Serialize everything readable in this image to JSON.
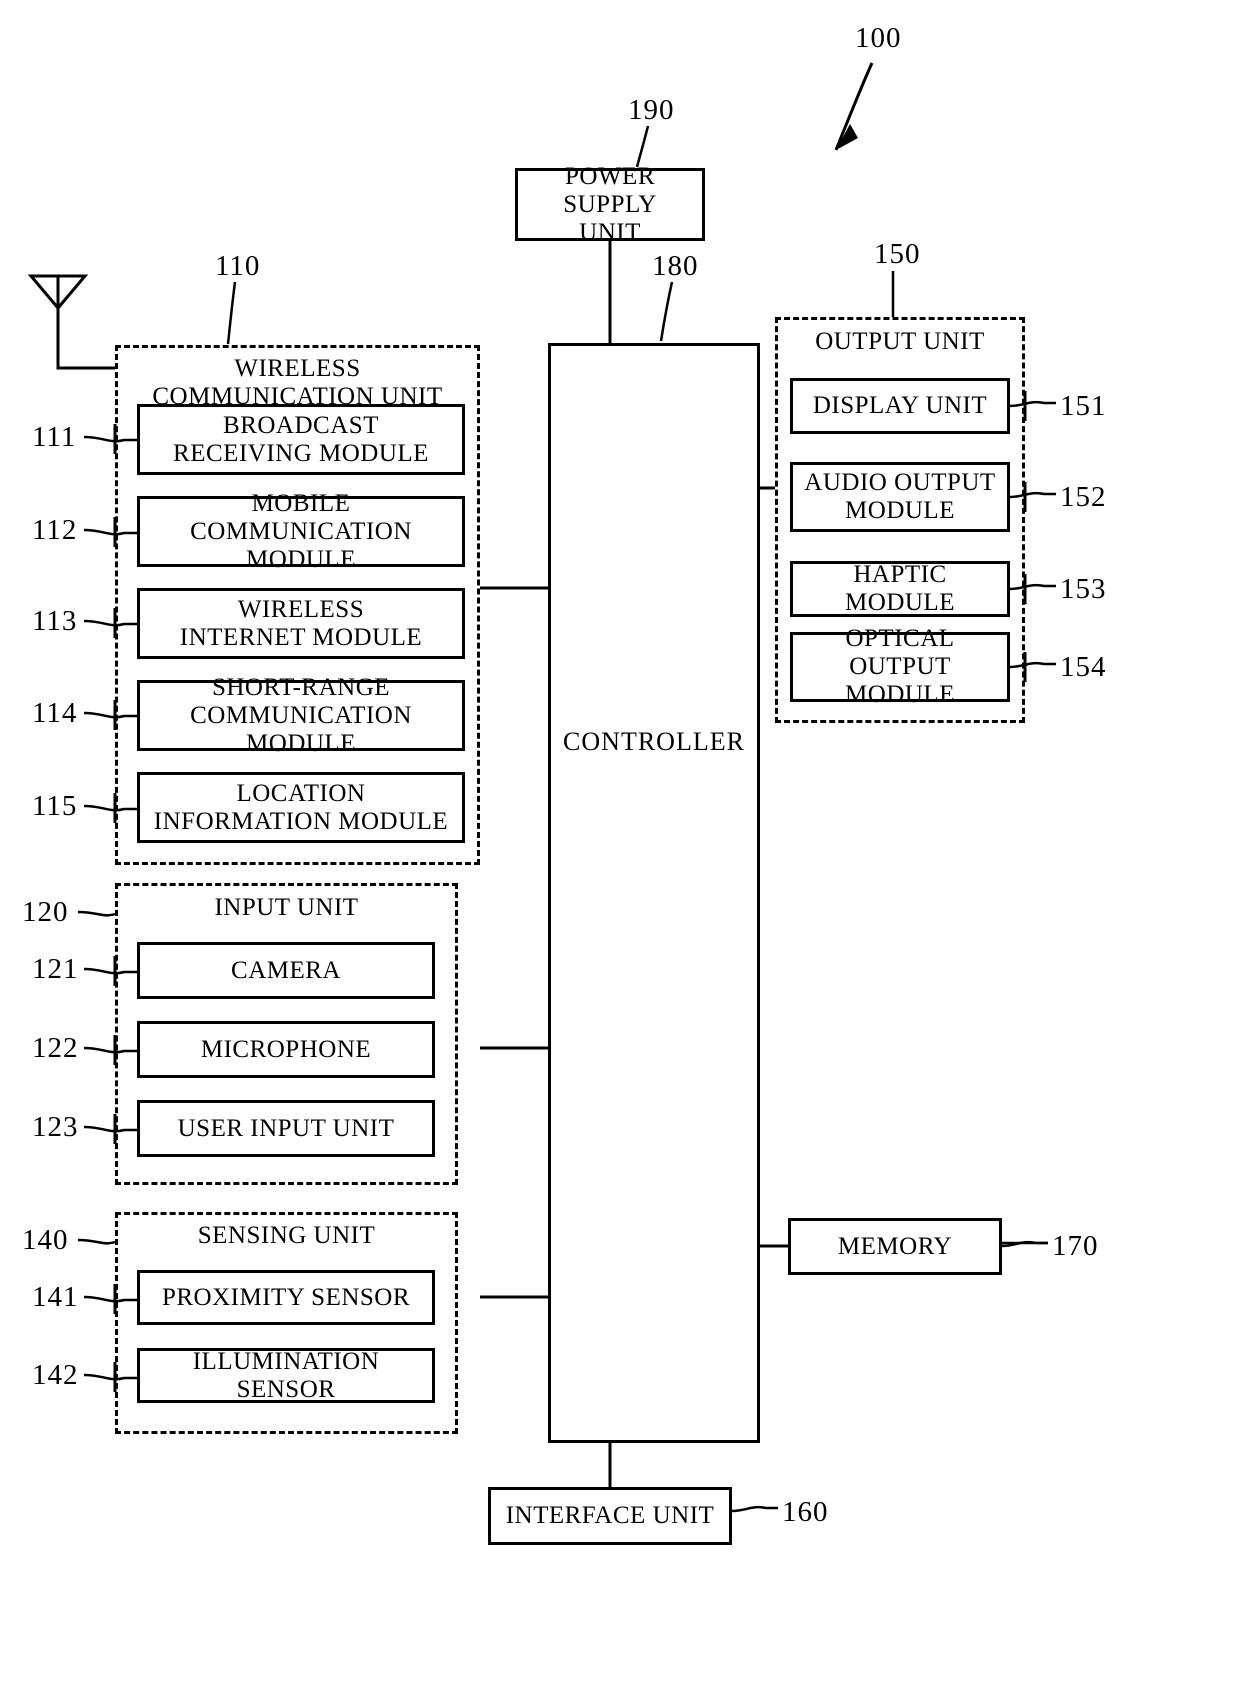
{
  "figure": {
    "device_ref": "100",
    "controller": {
      "label": "CONTROLLER",
      "ref": "180"
    },
    "power_supply": {
      "label": "POWER SUPPLY\nUNIT",
      "ref": "190"
    },
    "memory": {
      "label": "MEMORY",
      "ref": "170"
    },
    "interface": {
      "label": "INTERFACE UNIT",
      "ref": "160"
    },
    "antenna": {
      "name": "antenna-symbol"
    }
  },
  "wireless_unit": {
    "label": "WIRELESS\nCOMMUNICATION UNIT",
    "ref": "110",
    "modules": [
      {
        "ref": "111",
        "label": "BROADCAST\nRECEIVING MODULE"
      },
      {
        "ref": "112",
        "label": "MOBILE\nCOMMUNICATION MODULE"
      },
      {
        "ref": "113",
        "label": "WIRELESS\nINTERNET MODULE"
      },
      {
        "ref": "114",
        "label": "SHORT-RANGE\nCOMMUNICATION MODULE"
      },
      {
        "ref": "115",
        "label": "LOCATION\nINFORMATION MODULE"
      }
    ]
  },
  "input_unit": {
    "label": "INPUT UNIT",
    "ref": "120",
    "modules": [
      {
        "ref": "121",
        "label": "CAMERA"
      },
      {
        "ref": "122",
        "label": "MICROPHONE"
      },
      {
        "ref": "123",
        "label": "USER INPUT UNIT"
      }
    ]
  },
  "sensing_unit": {
    "label": "SENSING UNIT",
    "ref": "140",
    "modules": [
      {
        "ref": "141",
        "label": "PROXIMITY SENSOR"
      },
      {
        "ref": "142",
        "label": "ILLUMINATION SENSOR"
      }
    ]
  },
  "output_unit": {
    "label": "OUTPUT UNIT",
    "ref": "150",
    "modules": [
      {
        "ref": "151",
        "label": "DISPLAY UNIT"
      },
      {
        "ref": "152",
        "label": "AUDIO OUTPUT\nMODULE"
      },
      {
        "ref": "153",
        "label": "HAPTIC MODULE"
      },
      {
        "ref": "154",
        "label": "OPTICAL OUTPUT\nMODULE"
      }
    ]
  },
  "colors": {
    "ink": "#000000",
    "paper": "#ffffff"
  }
}
